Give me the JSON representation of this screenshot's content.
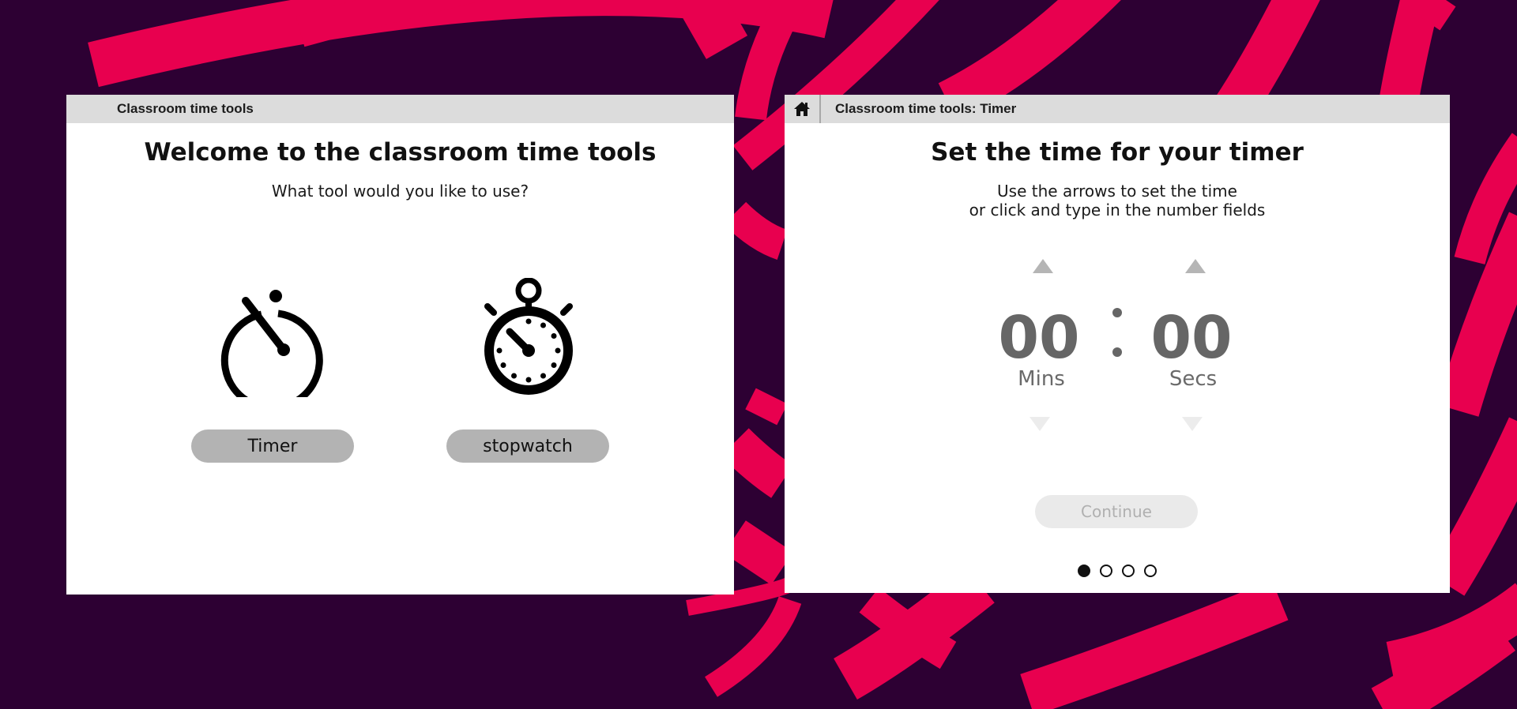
{
  "colors": {
    "background": "#2d0033",
    "accent_stripes": "#e8004f",
    "panel": "#ffffff",
    "titlebar": "#dcdcdc",
    "button": "#b3b3b3",
    "digits": "#666666",
    "continue_disabled_bg": "#eaeaea"
  },
  "welcome_panel": {
    "titlebar_label": "Classroom time tools",
    "heading": "Welcome to the classroom time tools",
    "prompt": "What tool would you like to use?",
    "tools": [
      {
        "icon": "timer-icon",
        "label": "Timer"
      },
      {
        "icon": "stopwatch-icon",
        "label": "stopwatch"
      }
    ]
  },
  "timer_panel": {
    "home_icon": "home-icon",
    "titlebar_label": "Classroom time tools: Timer",
    "heading": "Set the time for your timer",
    "instructions_line1": "Use the arrows to set the time",
    "instructions_line2": "or click and type in the number fields",
    "minutes": {
      "value": "00",
      "unit": "Mins"
    },
    "seconds": {
      "value": "00",
      "unit": "Secs"
    },
    "continue_label": "Continue",
    "continue_enabled": false,
    "steps": {
      "total": 4,
      "current": 1
    }
  }
}
